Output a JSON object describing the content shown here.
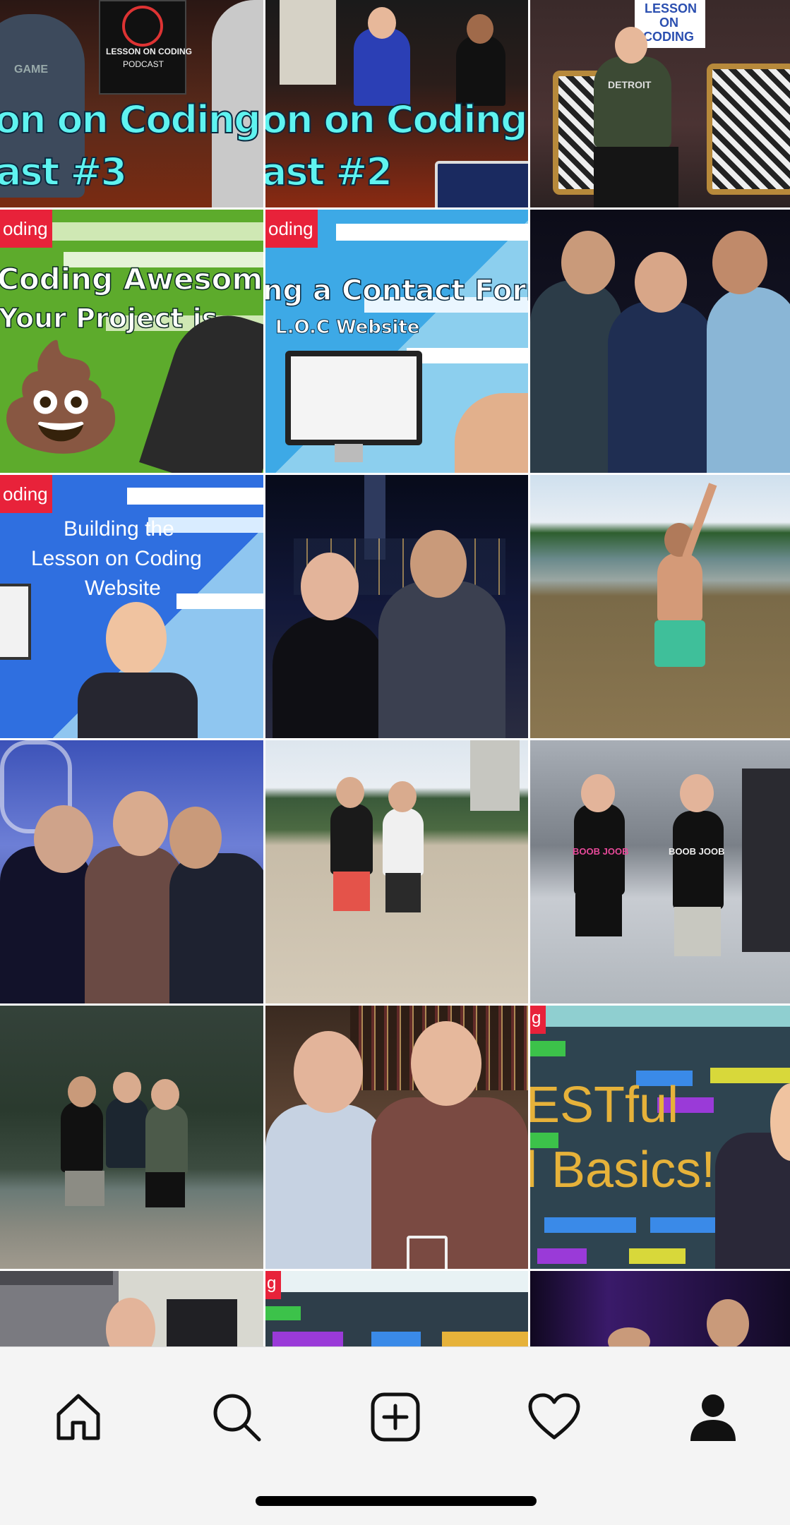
{
  "tiles": [
    {
      "id": "r1c1",
      "headline1": "on on Coding",
      "headline2": "ast #3",
      "sign": "LESSON ON CODING",
      "sign2": "PODCAST",
      "shirt": "GAME"
    },
    {
      "id": "r1c2",
      "headline1": "on on Coding",
      "headline2": "ast #2"
    },
    {
      "id": "r1c3",
      "sign1": "LESSON",
      "sign2": "ON",
      "sign3": "CODING",
      "shirt": "DETROIT"
    },
    {
      "id": "r2c1",
      "badge": "oding",
      "line1": "Coding Awesome",
      "line2": "Your Project is",
      "emoji": "💩"
    },
    {
      "id": "r2c2",
      "badge": "oding",
      "line1": "ng a Contact Form",
      "line2": "L.O.C Website"
    },
    {
      "id": "r2c3"
    },
    {
      "id": "r3c1",
      "badge": "oding",
      "line1": "Building the",
      "line2": "Lesson on Coding",
      "line3": "Website"
    },
    {
      "id": "r3c2"
    },
    {
      "id": "r3c3"
    },
    {
      "id": "r4c1"
    },
    {
      "id": "r4c2"
    },
    {
      "id": "r4c3",
      "shirt1": "BOOB JOOB",
      "shirt2": "BOOB JOOB"
    },
    {
      "id": "r5c1"
    },
    {
      "id": "r5c2"
    },
    {
      "id": "r5c3",
      "badge": "g",
      "line1": "ESTful",
      "line2": "l Basics!"
    },
    {
      "id": "r6c1"
    },
    {
      "id": "r6c2",
      "badge": "g"
    },
    {
      "id": "r6c3"
    }
  ],
  "nav": {
    "items": [
      {
        "name": "home",
        "icon": "home-icon"
      },
      {
        "name": "search",
        "icon": "search-icon"
      },
      {
        "name": "create",
        "icon": "plus-square-icon"
      },
      {
        "name": "activity",
        "icon": "heart-icon"
      },
      {
        "name": "profile",
        "icon": "person-icon"
      }
    ]
  },
  "colors": {
    "accent_red": "#e8223a",
    "headline_cyan": "#5ff3f0",
    "gold": "#e6b23a",
    "nav_bg": "#f4f4f4"
  }
}
